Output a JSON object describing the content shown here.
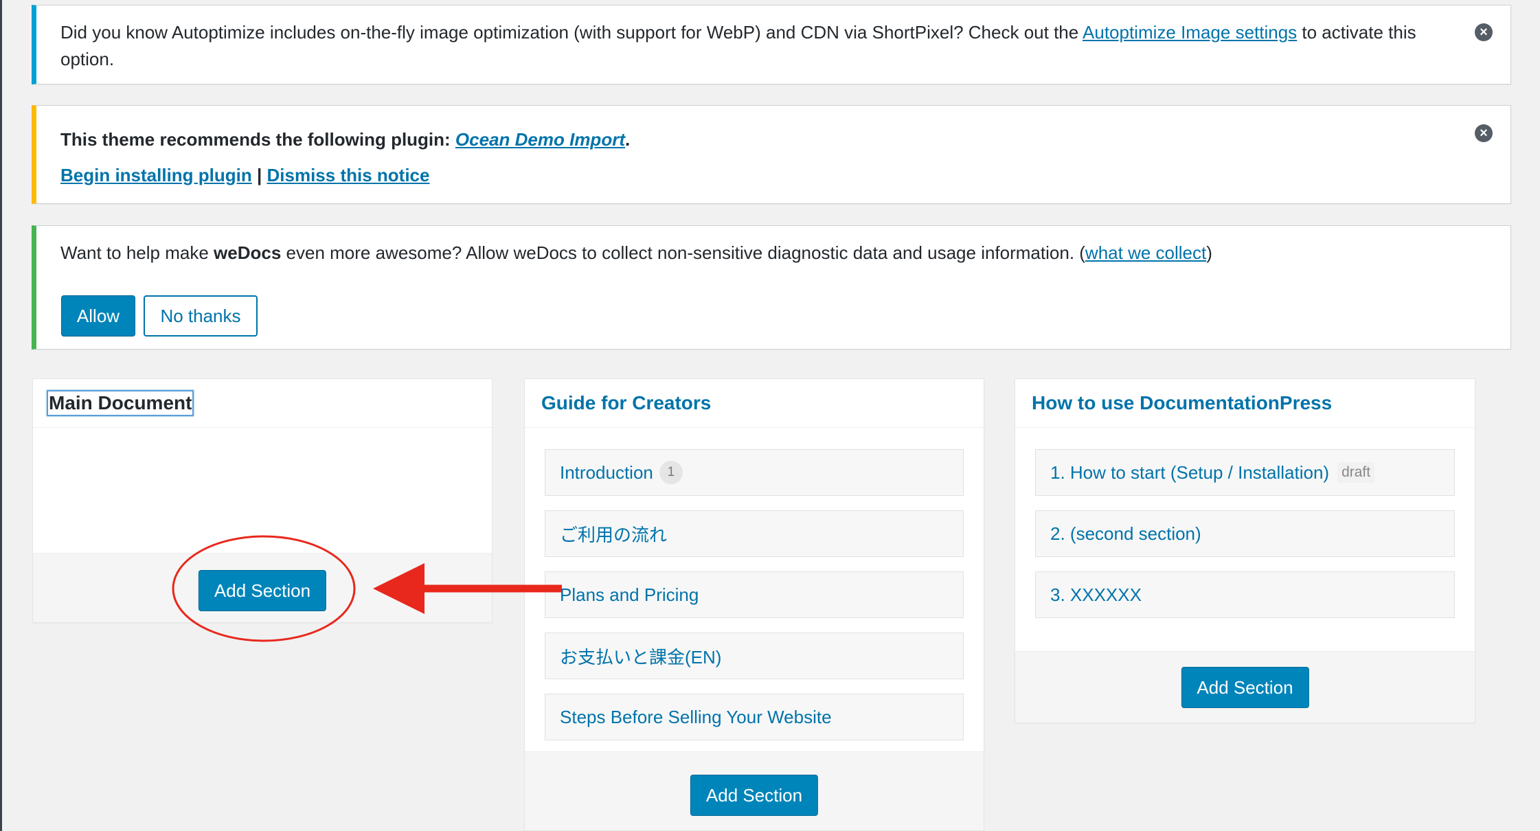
{
  "notices": {
    "autoptimize": {
      "text_before": "Did you know Autoptimize includes on-the-fly image optimization (with support for WebP) and CDN via ShortPixel? Check out the ",
      "link": "Autoptimize Image settings",
      "text_after": " to activate this option."
    },
    "theme_plugin": {
      "prefix": "This theme recommends the following plugin: ",
      "plugin_link": "Ocean Demo Import",
      "suffix": ".",
      "install_link": "Begin installing plugin",
      "separator": " | ",
      "dismiss_link": "Dismiss this notice"
    },
    "wedocs": {
      "text_1": "Want to help make ",
      "brand": "weDocs",
      "text_2": " even more awesome? Allow weDocs to collect non-sensitive diagnostic data and usage information. (",
      "link": "what we collect",
      "text_3": ")",
      "allow_label": "Allow",
      "no_thanks_label": "No thanks"
    }
  },
  "docs": [
    {
      "title": "Main Document",
      "sections": [],
      "add_label": "Add Section"
    },
    {
      "title": "Guide for Creators",
      "sections": [
        {
          "label": "Introduction",
          "badge": "1"
        },
        {
          "label": "ご利用の流れ"
        },
        {
          "label": "Plans and Pricing"
        },
        {
          "label": "お支払いと課金(EN)"
        },
        {
          "label": "Steps Before Selling Your Website"
        }
      ],
      "add_label": "Add Section"
    },
    {
      "title": "How to use DocumentationPress",
      "sections": [
        {
          "label": "1. How to start (Setup / Installation)",
          "status": "draft"
        },
        {
          "label": "2. (second section)"
        },
        {
          "label": "3. XXXXXX"
        }
      ],
      "add_label": "Add Section"
    }
  ],
  "colors": {
    "accent": "#0073aa",
    "button_primary": "#0085ba",
    "annotation_red": "#e8281c"
  }
}
